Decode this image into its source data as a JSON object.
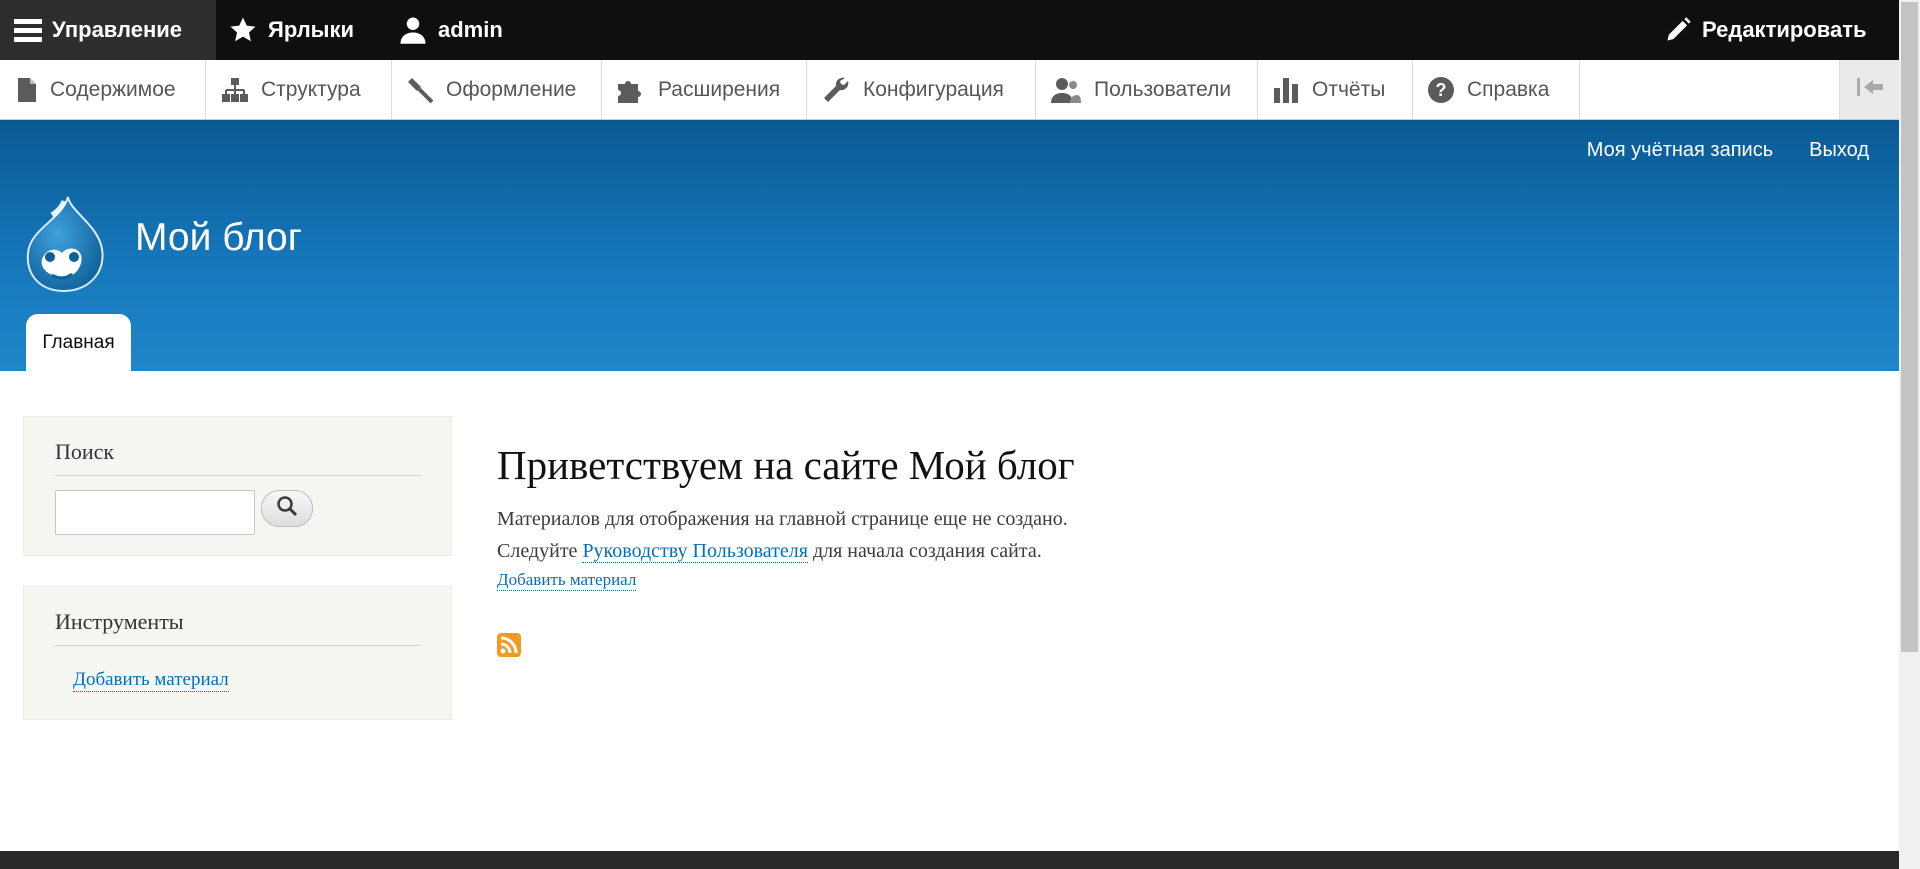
{
  "toolbar": {
    "manage_label": "Управление",
    "shortcuts_label": "Ярлыки",
    "user_label": "admin",
    "edit_label": "Редактировать"
  },
  "tray": {
    "items": [
      {
        "label": "Содержимое",
        "icon": "file-icon"
      },
      {
        "label": "Структура",
        "icon": "sitemap-icon"
      },
      {
        "label": "Оформление",
        "icon": "brush-icon"
      },
      {
        "label": "Расширения",
        "icon": "puzzle-icon"
      },
      {
        "label": "Конфигурация",
        "icon": "wrench-icon"
      },
      {
        "label": "Пользователи",
        "icon": "users-icon"
      },
      {
        "label": "Отчёты",
        "icon": "bar-chart-icon"
      },
      {
        "label": "Справка",
        "icon": "help-icon"
      }
    ],
    "toggle_icon": "collapse-tray-icon"
  },
  "header": {
    "account_link": "Моя учётная запись",
    "logout_link": "Выход",
    "site_name": "Мой блог",
    "tab_home": "Главная",
    "colors": {
      "top": "#0a5a93",
      "bottom": "#1f86c8"
    }
  },
  "sidebar": {
    "search_title": "Поиск",
    "search_placeholder": "",
    "tools_title": "Инструменты",
    "tools_link": "Добавить материал"
  },
  "main": {
    "title": "Приветствуем на сайте Мой блог",
    "line1": "Материалов для отображения на главной странице еще не создано.",
    "line2_before": "Следуйте ",
    "line2_link": "Руководству Пользователя",
    "line2_after": " для начала создания сайта.",
    "add_link": "Добавить материал"
  }
}
